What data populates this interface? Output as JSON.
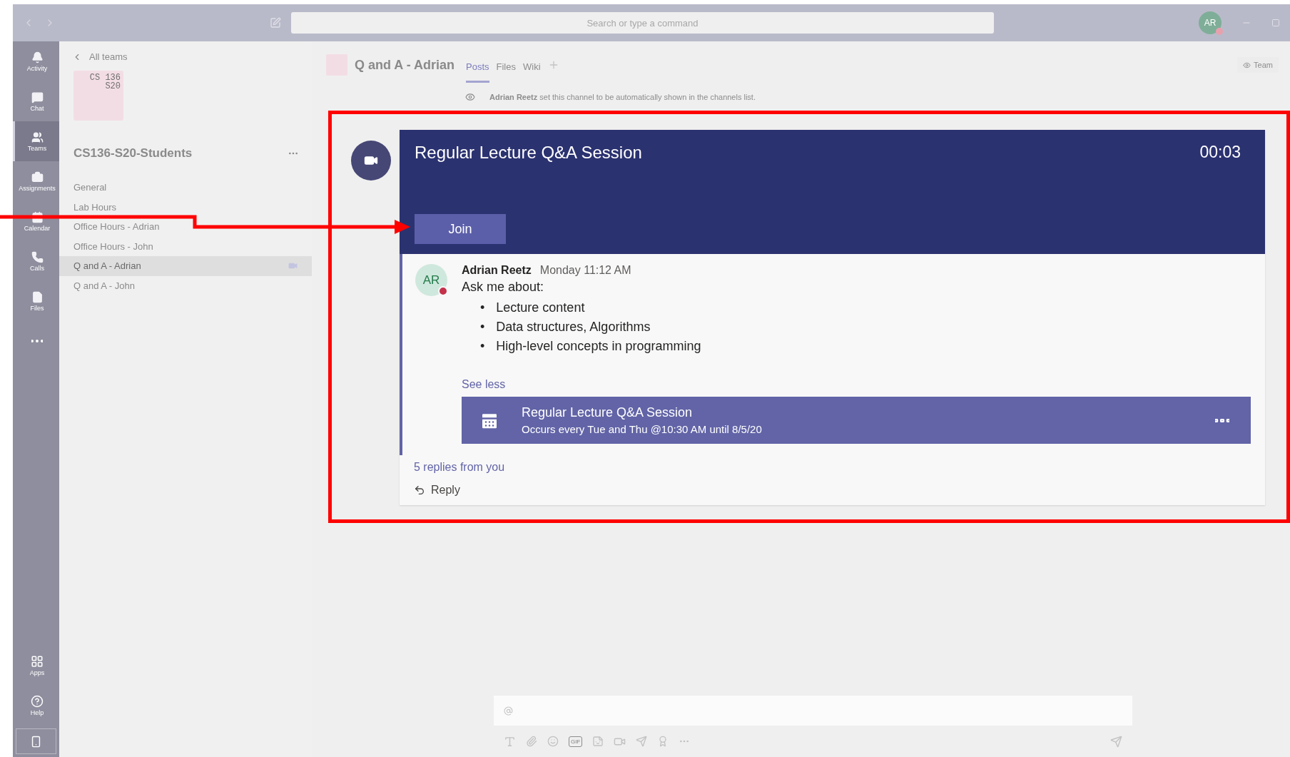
{
  "top_bar": {
    "search_placeholder": "Search or type a command",
    "avatar_initials": "AR"
  },
  "rail": [
    {
      "kind": "activity",
      "label": "Activity",
      "selected": false
    },
    {
      "kind": "chat",
      "label": "Chat",
      "selected": false
    },
    {
      "kind": "teams",
      "label": "Teams",
      "selected": true
    },
    {
      "kind": "assignments",
      "label": "Assignments",
      "selected": false
    },
    {
      "kind": "calendar",
      "label": "Calendar",
      "selected": false
    },
    {
      "kind": "calls",
      "label": "Calls",
      "selected": false
    },
    {
      "kind": "files",
      "label": "Files",
      "selected": false
    }
  ],
  "rail_bottom": [
    {
      "kind": "apps",
      "label": "Apps"
    },
    {
      "kind": "help",
      "label": "Help"
    }
  ],
  "sidebar": {
    "back_label": "All teams",
    "logo_lines": [
      "CS 136",
      "S20"
    ],
    "team_name": "CS136-S20-Students",
    "channels": [
      {
        "name": "General",
        "selected": false,
        "in_meeting": false
      },
      {
        "name": "Lab Hours",
        "selected": false,
        "in_meeting": false
      },
      {
        "name": "Office Hours - Adrian",
        "selected": false,
        "in_meeting": false
      },
      {
        "name": "Office Hours - John",
        "selected": false,
        "in_meeting": false
      },
      {
        "name": "Q and A - Adrian",
        "selected": true,
        "in_meeting": true
      },
      {
        "name": "Q and A - John",
        "selected": false,
        "in_meeting": false
      }
    ]
  },
  "channel_header": {
    "title": "Q and A - Adrian",
    "tabs": [
      {
        "label": "Posts",
        "selected": true
      },
      {
        "label": "Files",
        "selected": false
      },
      {
        "label": "Wiki",
        "selected": false
      }
    ],
    "team_button": "Team"
  },
  "notice": "**Adrian Reetz** set this channel to be automatically shown in the channels list.",
  "meeting": {
    "title": "Regular Lecture Q&A Session",
    "timer": "00:03",
    "join_label": "Join",
    "message": {
      "author_initials": "AR",
      "author": "Adrian Reetz",
      "time": "Monday 11:12 AM",
      "intro": "Ask me about:",
      "bullet_marker": "•",
      "bullets": [
        "Lecture content",
        "Data structures, Algorithms",
        "High-level concepts in programming"
      ],
      "see_less": "See less"
    },
    "event": {
      "title": "Regular Lecture Q&A Session",
      "subtitle": "Occurs every Tue and Thu @10:30 AM until 8/5/20"
    },
    "replies": "5 replies from you",
    "reply_label": "Reply"
  },
  "composer": {
    "gif_label": "GIF"
  }
}
